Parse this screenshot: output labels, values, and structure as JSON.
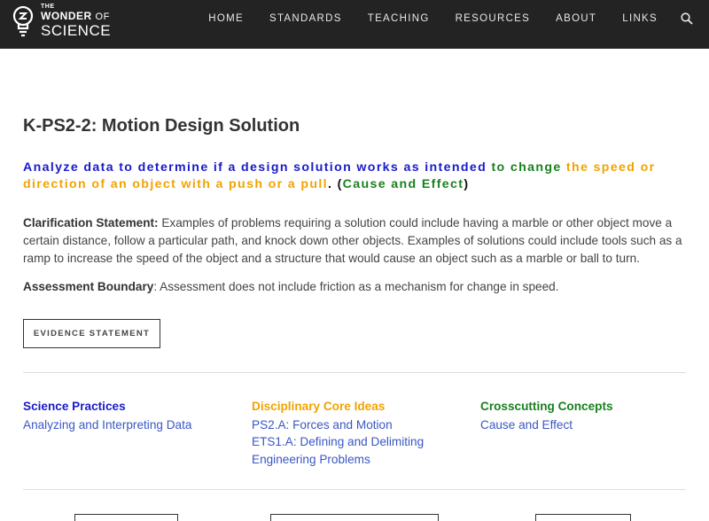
{
  "header": {
    "logo_the": "THE",
    "logo_wonder": "WONDER",
    "logo_of": "OF",
    "logo_science": "SCIENCE",
    "nav": [
      "HOME",
      "STANDARDS",
      "TEACHING",
      "RESOURCES",
      "ABOUT",
      "LINKS"
    ],
    "search_icon": "search-icon"
  },
  "page": {
    "title": "K-PS2-2: Motion Design Solution",
    "performance_expectation": {
      "part_blue": "Analyze data to determine if a design solution works as intended",
      "part_green": " to change ",
      "part_orange": "the speed or direction of an object with a push or a pull",
      "part_end_dot": ". ",
      "part_cc_open": "(",
      "part_cc": "Cause and Effect",
      "part_cc_close": ")"
    },
    "clarification_label": "Clarification Statement:",
    "clarification_text": " Examples of problems requiring a solution could include having a marble or other object move a certain distance, follow a particular path, and knock down other objects. Examples of solutions could include tools such as a ramp to increase the speed of the object and a structure that would cause an object such as a marble or ball to turn.",
    "assessment_label": "Assessment Boundary",
    "assessment_text": ": Assessment does not include friction as a mechanism for change in speed.",
    "evidence_button": "EVIDENCE STATEMENT"
  },
  "dimensions": {
    "science_practices": {
      "heading": "Science Practices",
      "links": [
        "Analyzing and Interpreting Data"
      ]
    },
    "core_ideas": {
      "heading": "Disciplinary Core Ideas",
      "links": [
        "PS2.A: Forces and Motion",
        "ETS1.A: Defining and Delimiting Engineering Problems"
      ]
    },
    "crosscutting": {
      "heading": "Crosscutting Concepts",
      "links": [
        "Cause and Effect"
      ]
    }
  },
  "colors": {
    "header_bg": "#232323",
    "sep_blue": "#1a1acc",
    "dci_orange": "#f2a300",
    "ccc_green": "#18801e",
    "link_blue": "#3a57c4"
  }
}
